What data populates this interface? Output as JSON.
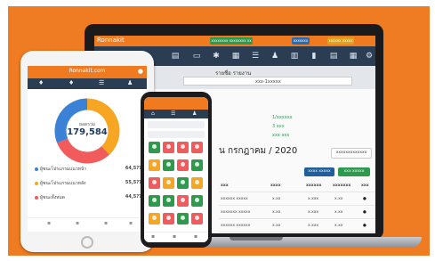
{
  "laptop": {
    "brand": "Ronnakit",
    "pills": [
      {
        "label": "xxxxxxxx xxxxxxxx xx",
        "color": "#2e9a4e"
      },
      {
        "label": "xxxxxxx",
        "color": "#2b6cb0"
      },
      {
        "label": "xxxxxx xxxxx",
        "color": "#e0a21a"
      }
    ],
    "page_title": "รายชื่อ รายงาน",
    "select_value": "xxx-1xxxxx",
    "status_lines": [
      "1/xxxxxx",
      "3 xxx",
      "xxx xxx"
    ],
    "month_heading": "น กรกฎาคม / 2020",
    "buttons": [
      {
        "label": "xxxxxxxxxxxxx",
        "color": "#ffffff"
      },
      {
        "label": "xxxx xxxxx",
        "color": "#1f5f9e"
      },
      {
        "label": "xxx xxxxx",
        "color": "#2e9a4e"
      }
    ],
    "table_headers": [
      "xxx",
      "xxxx",
      "xxxxxx",
      "xxxxxxx",
      "xxx"
    ],
    "rows": [
      [
        "xxxxxx xxxxx",
        "x.xx",
        "x.xxx",
        "x.xx"
      ],
      [
        "xxxxxxx xxxxx",
        "x.xx",
        "x.xxx",
        "x.xx"
      ],
      [
        "xxxxxx xxxxxx",
        "x.xx",
        "x.xxx",
        "x.xx"
      ]
    ]
  },
  "tablet": {
    "title": "Ronnakit.com",
    "total_label": "ยอดรวม",
    "total_value": "179,584",
    "donut": [
      {
        "fraction": 0.38,
        "color": "#f6a623"
      },
      {
        "fraction": 0.31,
        "color": "#f15b5b"
      },
      {
        "fraction": 0.31,
        "color": "#3b82d6"
      }
    ],
    "legend": [
      {
        "label": "ผู้ชนะโปรแกรมแนวหน้า",
        "value": "64,5??",
        "color": "#3b82d6"
      },
      {
        "label": "ผู้ชนะโปรแกรมแนวหลัง",
        "value": "55,5??",
        "color": "#f6a623"
      },
      {
        "label": "ผู้ชนะทั้งหมด",
        "value": "44,5??",
        "color": "#f15b5b"
      }
    ]
  },
  "phone": {
    "tiles": [
      [
        "#2e9a4e",
        "#f15b5b",
        "#f15b5b",
        "#f15b5b"
      ],
      [
        "#f6a623",
        "#2e9a4e",
        "#f15b5b",
        "#2e9a4e"
      ],
      [
        "#f15b5b",
        "#f6a623",
        "#2e9a4e",
        "#f6a623"
      ],
      [
        "#2e9a4e",
        "#2e9a4e",
        "#f15b5b",
        "#2e9a4e"
      ],
      [
        "#f6a623",
        "#f15b5b",
        "#2e9a4e",
        "#f15b5b"
      ]
    ]
  }
}
